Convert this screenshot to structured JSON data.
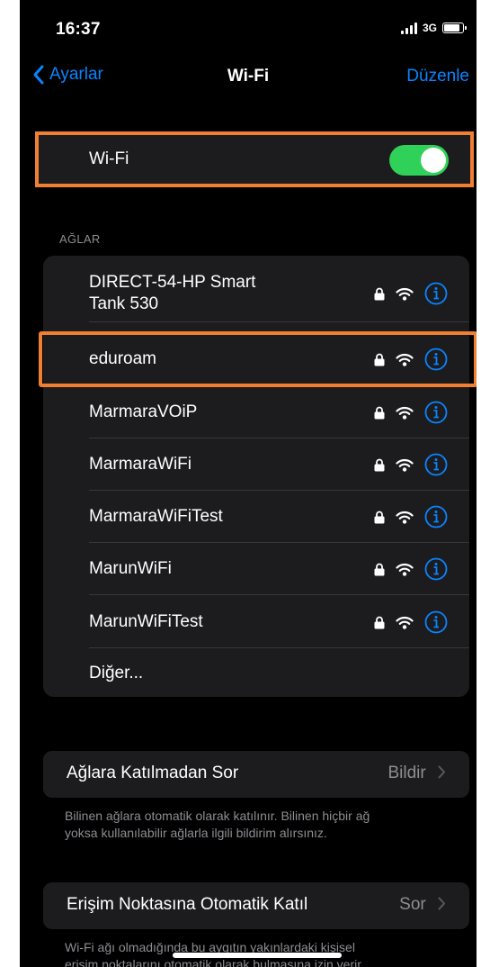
{
  "status": {
    "time": "16:37",
    "network": "3G",
    "battery_level": 0.9
  },
  "nav": {
    "back_label": "Ayarlar",
    "title": "Wi-Fi",
    "edit_label": "Düzenle"
  },
  "wifi": {
    "label": "Wi-Fi",
    "enabled": true
  },
  "networks_header": "AĞLAR",
  "networks": [
    {
      "name_line1": "DIRECT-54-HP Smart",
      "name_line2": "Tank 530"
    },
    {
      "name": "eduroam"
    },
    {
      "name": "MarmaraVOiP"
    },
    {
      "name": "MarmaraWiFi"
    },
    {
      "name": "MarmaraWiFiTest"
    },
    {
      "name": "MarunWiFi"
    },
    {
      "name": "MarunWiFiTest"
    },
    {
      "name": "Diğer..."
    }
  ],
  "ask_to_join": {
    "label": "Ağlara Katılmadan Sor",
    "value": "Bildir",
    "footer_line1": "Bilinen ağlara otomatik olarak katılınır. Bilinen hiçbir ağ",
    "footer_line2": "yoksa kullanılabilir ağlarla ilgili bildirim alırsınız."
  },
  "auto_join_hotspot": {
    "label": "Erişim Noktasına Otomatik Katıl",
    "value": "Sor",
    "footer_line1": "Wi-Fi ağı olmadığında bu aygıtın yakınlardaki kişisel",
    "footer_line2": "erişim noktalarını otomatik olarak bulmasına izin verir."
  },
  "colors": {
    "accent": "#0a84ff",
    "toggle_on": "#30d158",
    "highlight": "#f07f32",
    "cell": "#1c1c1e"
  }
}
